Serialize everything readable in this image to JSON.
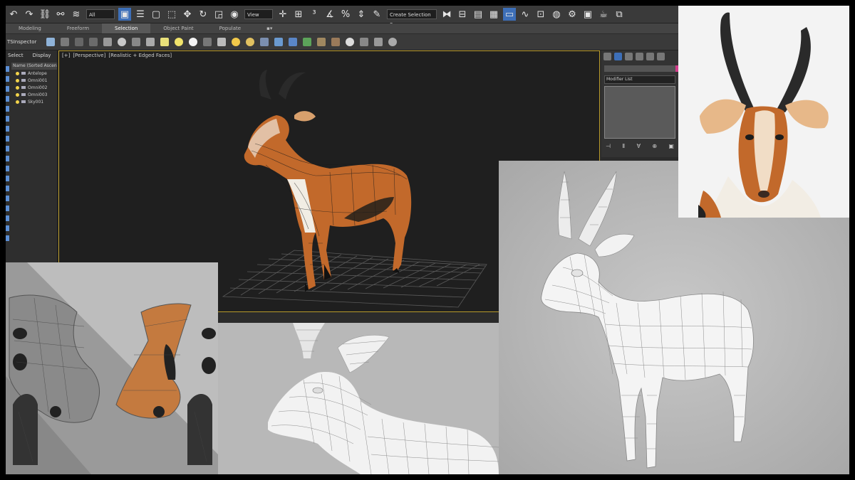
{
  "toolbar": {
    "filter_select": "All",
    "view_select": "View",
    "selection_set": "Create Selection Se",
    "icons": [
      "undo-icon",
      "redo-icon",
      "link-icon",
      "unlink-icon",
      "bind-spacewarp-icon",
      "select-object-icon",
      "select-by-name-icon",
      "rect-region-icon",
      "window-crossing-icon",
      "move-icon",
      "rotate-icon",
      "scale-icon",
      "snaps-icon",
      "angle-snap-icon",
      "percent-snap-icon",
      "spinner-snap-icon",
      "mirror-icon",
      "align-icon",
      "layer-icon",
      "toggle-ribbon-icon",
      "curve-editor-icon",
      "schematic-view-icon",
      "material-editor-icon",
      "render-setup-icon",
      "render-icon"
    ]
  },
  "ribbon": {
    "tabs": [
      {
        "label": "Modeling",
        "active": false
      },
      {
        "label": "Freeform",
        "active": false
      },
      {
        "label": "Selection",
        "active": true
      },
      {
        "label": "Object Paint",
        "active": false
      },
      {
        "label": "Populate",
        "active": false
      }
    ]
  },
  "toolbar2": {
    "label": "TSInspector"
  },
  "scene_explorer": {
    "tabs": [
      "Select",
      "Display"
    ],
    "header": "Name (Sorted Ascen",
    "items": [
      {
        "label": "Antelope",
        "type": "group"
      },
      {
        "label": "Omni001",
        "type": "light"
      },
      {
        "label": "Omni002",
        "type": "light"
      },
      {
        "label": "Omni003",
        "type": "light"
      },
      {
        "label": "Sky001",
        "type": "light"
      }
    ]
  },
  "viewport": {
    "labels": [
      "[+]",
      "[Perspective]",
      "[Realistic + Edged Faces]"
    ]
  },
  "command_panel": {
    "modifier_list": "Modifier List",
    "accent_color": "#d43c8c"
  },
  "colors": {
    "antelope_fur": "#c2692b",
    "horn": "#2a2a2a",
    "viewport_border": "#b89a2a"
  }
}
